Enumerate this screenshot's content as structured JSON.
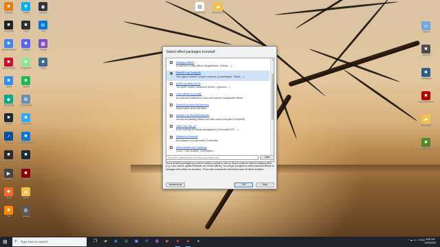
{
  "desktop": {
    "left_icons": [
      {
        "label": "Blender",
        "icon": "blender-icon",
        "color": "#e87d0d"
      },
      {
        "label": "Unity Hub",
        "icon": "unity-icon",
        "color": "#222222"
      },
      {
        "label": "Google Chrome",
        "icon": "chrome-icon",
        "color": "#4285f4"
      },
      {
        "label": "Adobe Reader",
        "icon": "adobe-icon",
        "color": "#c8102e"
      },
      {
        "label": "Zoom",
        "icon": "zoom-icon",
        "color": "#2d8cff"
      },
      {
        "label": "Kaspersky",
        "icon": "shield-icon",
        "color": "#00a88e"
      },
      {
        "label": "Steam",
        "icon": "steam-icon",
        "color": "#1b2838"
      },
      {
        "label": "Audacity",
        "icon": "audio-icon",
        "color": "#0050a0"
      },
      {
        "label": "Epic Games",
        "icon": "game-icon",
        "color": "#2a2a2a"
      },
      {
        "label": "Davinci",
        "icon": "video-icon",
        "color": "#444444"
      },
      {
        "label": "Origin",
        "icon": "origin-icon",
        "color": "#f56c2d"
      },
      {
        "label": "VLC",
        "icon": "vlc-icon",
        "color": "#ff8800"
      },
      {
        "label": "Skype",
        "icon": "skype-icon",
        "color": "#00aff0"
      },
      {
        "label": "OBS",
        "icon": "obs-icon",
        "color": "#302e31"
      },
      {
        "label": "Discord",
        "icon": "discord-icon",
        "color": "#5865f2"
      },
      {
        "label": "Notepad++",
        "icon": "notepad-icon",
        "color": "#90e59a"
      },
      {
        "label": "Spotify",
        "icon": "spotify-icon",
        "color": "#1db954"
      },
      {
        "label": "Recycle Bin",
        "icon": "recycle-icon",
        "color": "#6a8fb5"
      },
      {
        "label": "Photoshop",
        "icon": "photoshop-icon",
        "color": "#31a8ff"
      },
      {
        "label": "Microsoft Edge",
        "icon": "edge-icon",
        "color": "#0c7bd7"
      },
      {
        "label": "Steam",
        "icon": "steam-icon",
        "color": "#1b2838"
      },
      {
        "label": "Game",
        "icon": "game-icon",
        "color": "#8b0000"
      },
      {
        "label": "Folder",
        "icon": "folder-icon",
        "color": "#f2c14e"
      },
      {
        "label": "Settings",
        "icon": "gear-icon",
        "color": "#5a5a5a"
      },
      {
        "label": "Camera",
        "icon": "camera-icon",
        "color": "#333333"
      },
      {
        "label": "Mail",
        "icon": "mail-icon",
        "color": "#0078d4"
      },
      {
        "label": "Photos",
        "icon": "photo-icon",
        "color": "#7a4fbf"
      },
      {
        "label": "Tools",
        "icon": "tool-icon",
        "color": "#3d6b8e"
      }
    ],
    "top_icons": [
      {
        "label": "Adobe Pho...",
        "icon": "document-icon",
        "color": "#ffffff"
      },
      {
        "label": "New folder (2)",
        "icon": "folder-icon",
        "color": "#f2c14e"
      }
    ],
    "right_icons": [
      {
        "label": "This PC",
        "icon": "computer-icon",
        "color": "#6fa8dc"
      },
      {
        "label": "OptiFine",
        "icon": "app-icon",
        "color": "#4d4d4d"
      },
      {
        "label": "WinDirStat",
        "icon": "app-icon",
        "color": "#2e5c8a"
      },
      {
        "label": "MSI Afterburner",
        "icon": "app-icon",
        "color": "#b30000"
      },
      {
        "label": "New folder",
        "icon": "folder-icon",
        "color": "#f2c14e"
      },
      {
        "label": "Plants vs Zombies",
        "icon": "game-icon",
        "color": "#4f8a2b"
      }
    ]
  },
  "dialog": {
    "title": "Select effect packages to install:",
    "packages": [
      {
        "name": "Standard effects",
        "desc": "A small set of utility effects (DisplayDepth, UIMask, ...)",
        "control": "checkbox",
        "checked": true,
        "selected": false
      },
      {
        "name": "SweetFX by Ceejay.dk",
        "desc": "The original SweetFX shader collection (LumaSharpen, SMAA, ...)",
        "control": "radio",
        "checked": true,
        "selected": true
      },
      {
        "name": "qUINT by Marty McFly",
        "desc": "The qUINT shader framework (MXAO, Lightroom, ...)",
        "control": "checkbox",
        "checked": false,
        "selected": false
      },
      {
        "name": "Color effects by prod80",
        "desc": "An extensive collection of color and contrast manipulation effects",
        "control": "checkbox",
        "checked": false,
        "selected": false
      },
      {
        "name": "Depth3D by BlueSkyDefender",
        "desc": "Depth-based stereo 3D effect",
        "control": "checkbox",
        "checked": false,
        "selected": false
      },
      {
        "name": "AstrayFX by BlueSkyDefender",
        "desc": "Various anti-aliasing effects and more (used to be part of Depth3D)",
        "control": "checkbox",
        "checked": false,
        "selected": false
      },
      {
        "name": "OtisFX by Otis_Inf",
        "desc": "A set of effects for virtual photographers (Cinematic DOF, ...)",
        "control": "checkbox",
        "checked": false,
        "selected": false
      },
      {
        "name": "Shaders by brussell",
        "desc": "Eye Adaption and automatic UI detection",
        "control": "checkbox",
        "checked": false,
        "selected": false
      },
      {
        "name": "fubax-shaders by Fubaxiusz",
        "desc": "Comic, Color Isolation, Composition, ...",
        "control": "checkbox",
        "checked": false,
        "selected": false
      }
    ],
    "url_placeholder": "Enter ZIP download link to custom repository here",
    "add_label": "Add",
    "info": "Check all effect packages you want to install or update or click on Skip to continue without modifying them (e.g. if you want to update ReShade, but not the effects). You will get prompted to select individual effects for packages with a filled out checkbox. Those with a checkmark will instead have all effects installed.",
    "uncheck_all_label": "Uncheck all",
    "ok_label": "OK",
    "skip_label": "Skip"
  },
  "taskbar": {
    "start_icon": "windows-logo-icon",
    "search_placeholder": "Type here to search",
    "apps": [
      {
        "icon": "task-view-icon",
        "glyph": "❐",
        "color": "#dddddd",
        "active": false
      },
      {
        "icon": "file-explorer-icon",
        "glyph": "▰",
        "color": "#f2c14e",
        "active": false
      },
      {
        "icon": "edge-icon",
        "glyph": "◉",
        "color": "#2f9ae0",
        "active": false
      },
      {
        "icon": "chrome-icon",
        "glyph": "◍",
        "color": "#4caf50",
        "active": false
      },
      {
        "icon": "store-icon",
        "glyph": "▣",
        "color": "#6aa0ff",
        "active": false
      },
      {
        "icon": "mail-icon",
        "glyph": "✉",
        "color": "#3a8ee6",
        "active": false
      },
      {
        "icon": "photos-icon",
        "glyph": "▦",
        "color": "#b06ad8",
        "active": false
      },
      {
        "icon": "media-icon",
        "glyph": "▶",
        "color": "#e06c2f",
        "active": false
      },
      {
        "icon": "game-icon",
        "glyph": "◆",
        "color": "#c0392b",
        "active": true
      },
      {
        "icon": "reshade-icon",
        "glyph": "◈",
        "color": "#e74c3c",
        "active": true
      },
      {
        "icon": "steam-icon",
        "glyph": "●",
        "color": "#9fb4c8",
        "active": false
      }
    ],
    "tray_text": "^  ☁  ▭  ♪  ENG",
    "time": "8:25 PM",
    "date": "12/04/2021"
  }
}
